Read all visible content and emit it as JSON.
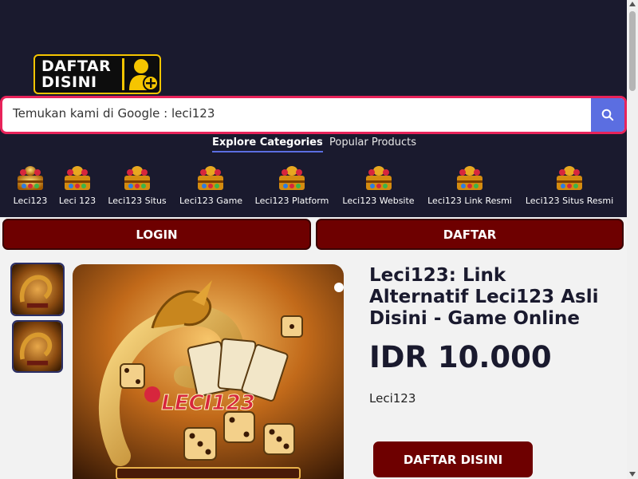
{
  "logo": {
    "line1": "DAFTAR",
    "line2": "DISINI",
    "icon": "user-plus-icon"
  },
  "search": {
    "text": "Temukan kami di Google : leci123",
    "icon": "search-icon"
  },
  "tabs": [
    {
      "label": "Explore Categories",
      "active": true
    },
    {
      "label": "Popular Products",
      "active": false
    }
  ],
  "categories": [
    {
      "label": "Leci123"
    },
    {
      "label": "Leci 123"
    },
    {
      "label": "Leci123 Situs"
    },
    {
      "label": "Leci123 Game"
    },
    {
      "label": "Leci123 Platform"
    },
    {
      "label": "Leci123 Website"
    },
    {
      "label": "Leci123 Link Resmi"
    },
    {
      "label": "Leci123 Situs Resmi"
    }
  ],
  "buttons": {
    "login": "LOGIN",
    "daftar": "DAFTAR",
    "cta": "DAFTAR DISINI"
  },
  "product": {
    "title": "Leci123: Link Alternatif Leci123 Asli Disini - Game Online",
    "price": "IDR 10.000",
    "brand": "Leci123",
    "image_watermark": "LECI123"
  },
  "colors": {
    "header_bg": "#1a1a2e",
    "accent": "#5b6ee1",
    "button_bg": "#6e0000",
    "search_border": "#e8235a",
    "logo_yellow": "#f5c500"
  }
}
